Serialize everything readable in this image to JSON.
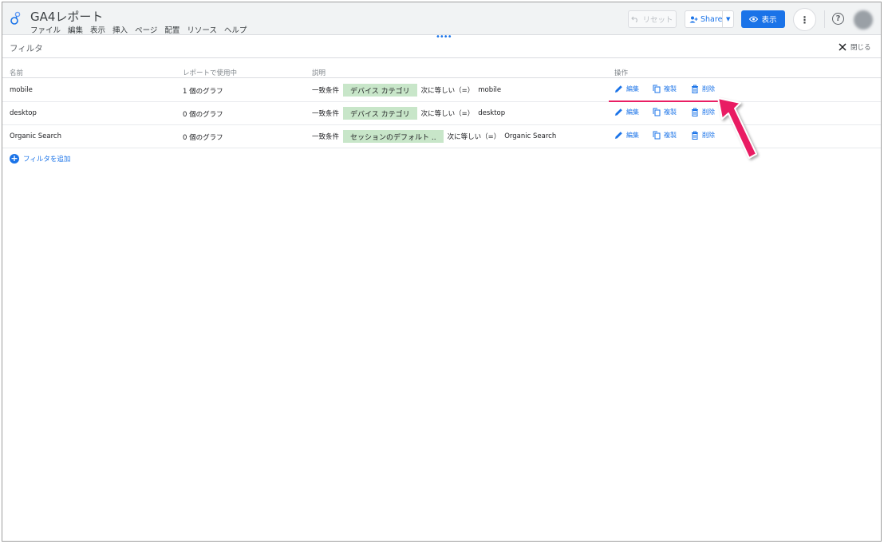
{
  "app": {
    "title": "GA4レポート",
    "menu": [
      "ファイル",
      "編集",
      "表示",
      "挿入",
      "ページ",
      "配置",
      "リソース",
      "ヘルプ"
    ]
  },
  "toolbar": {
    "reset_label": "リセット",
    "share_label": "Share",
    "view_label": "表示"
  },
  "panel": {
    "title": "フィルタ",
    "close_label": "閉じる"
  },
  "table": {
    "headers": [
      "名前",
      "レポートで使用中",
      "説明",
      "操作"
    ],
    "rows": [
      {
        "name": "mobile",
        "usage": "1 個のグラフ",
        "condition": "一致条件",
        "dimension": "デバイス カテゴリ",
        "operator": "次に等しい（=）",
        "value": "mobile"
      },
      {
        "name": "desktop",
        "usage": "0 個のグラフ",
        "condition": "一致条件",
        "dimension": "デバイス カテゴリ",
        "operator": "次に等しい（=）",
        "value": "desktop"
      },
      {
        "name": "Organic Search",
        "usage": "0 個のグラフ",
        "condition": "一致条件",
        "dimension": "セッションのデフォルト ..",
        "operator": "次に等しい（=）",
        "value": "Organic Search"
      }
    ],
    "actions": {
      "edit": "編集",
      "copy": "複製",
      "delete": "削除"
    }
  },
  "add_filter_label": "フィルタを追加",
  "colors": {
    "accent": "#1a73e8",
    "chip": "#c8e6c9",
    "annotation": "#e91e63"
  }
}
